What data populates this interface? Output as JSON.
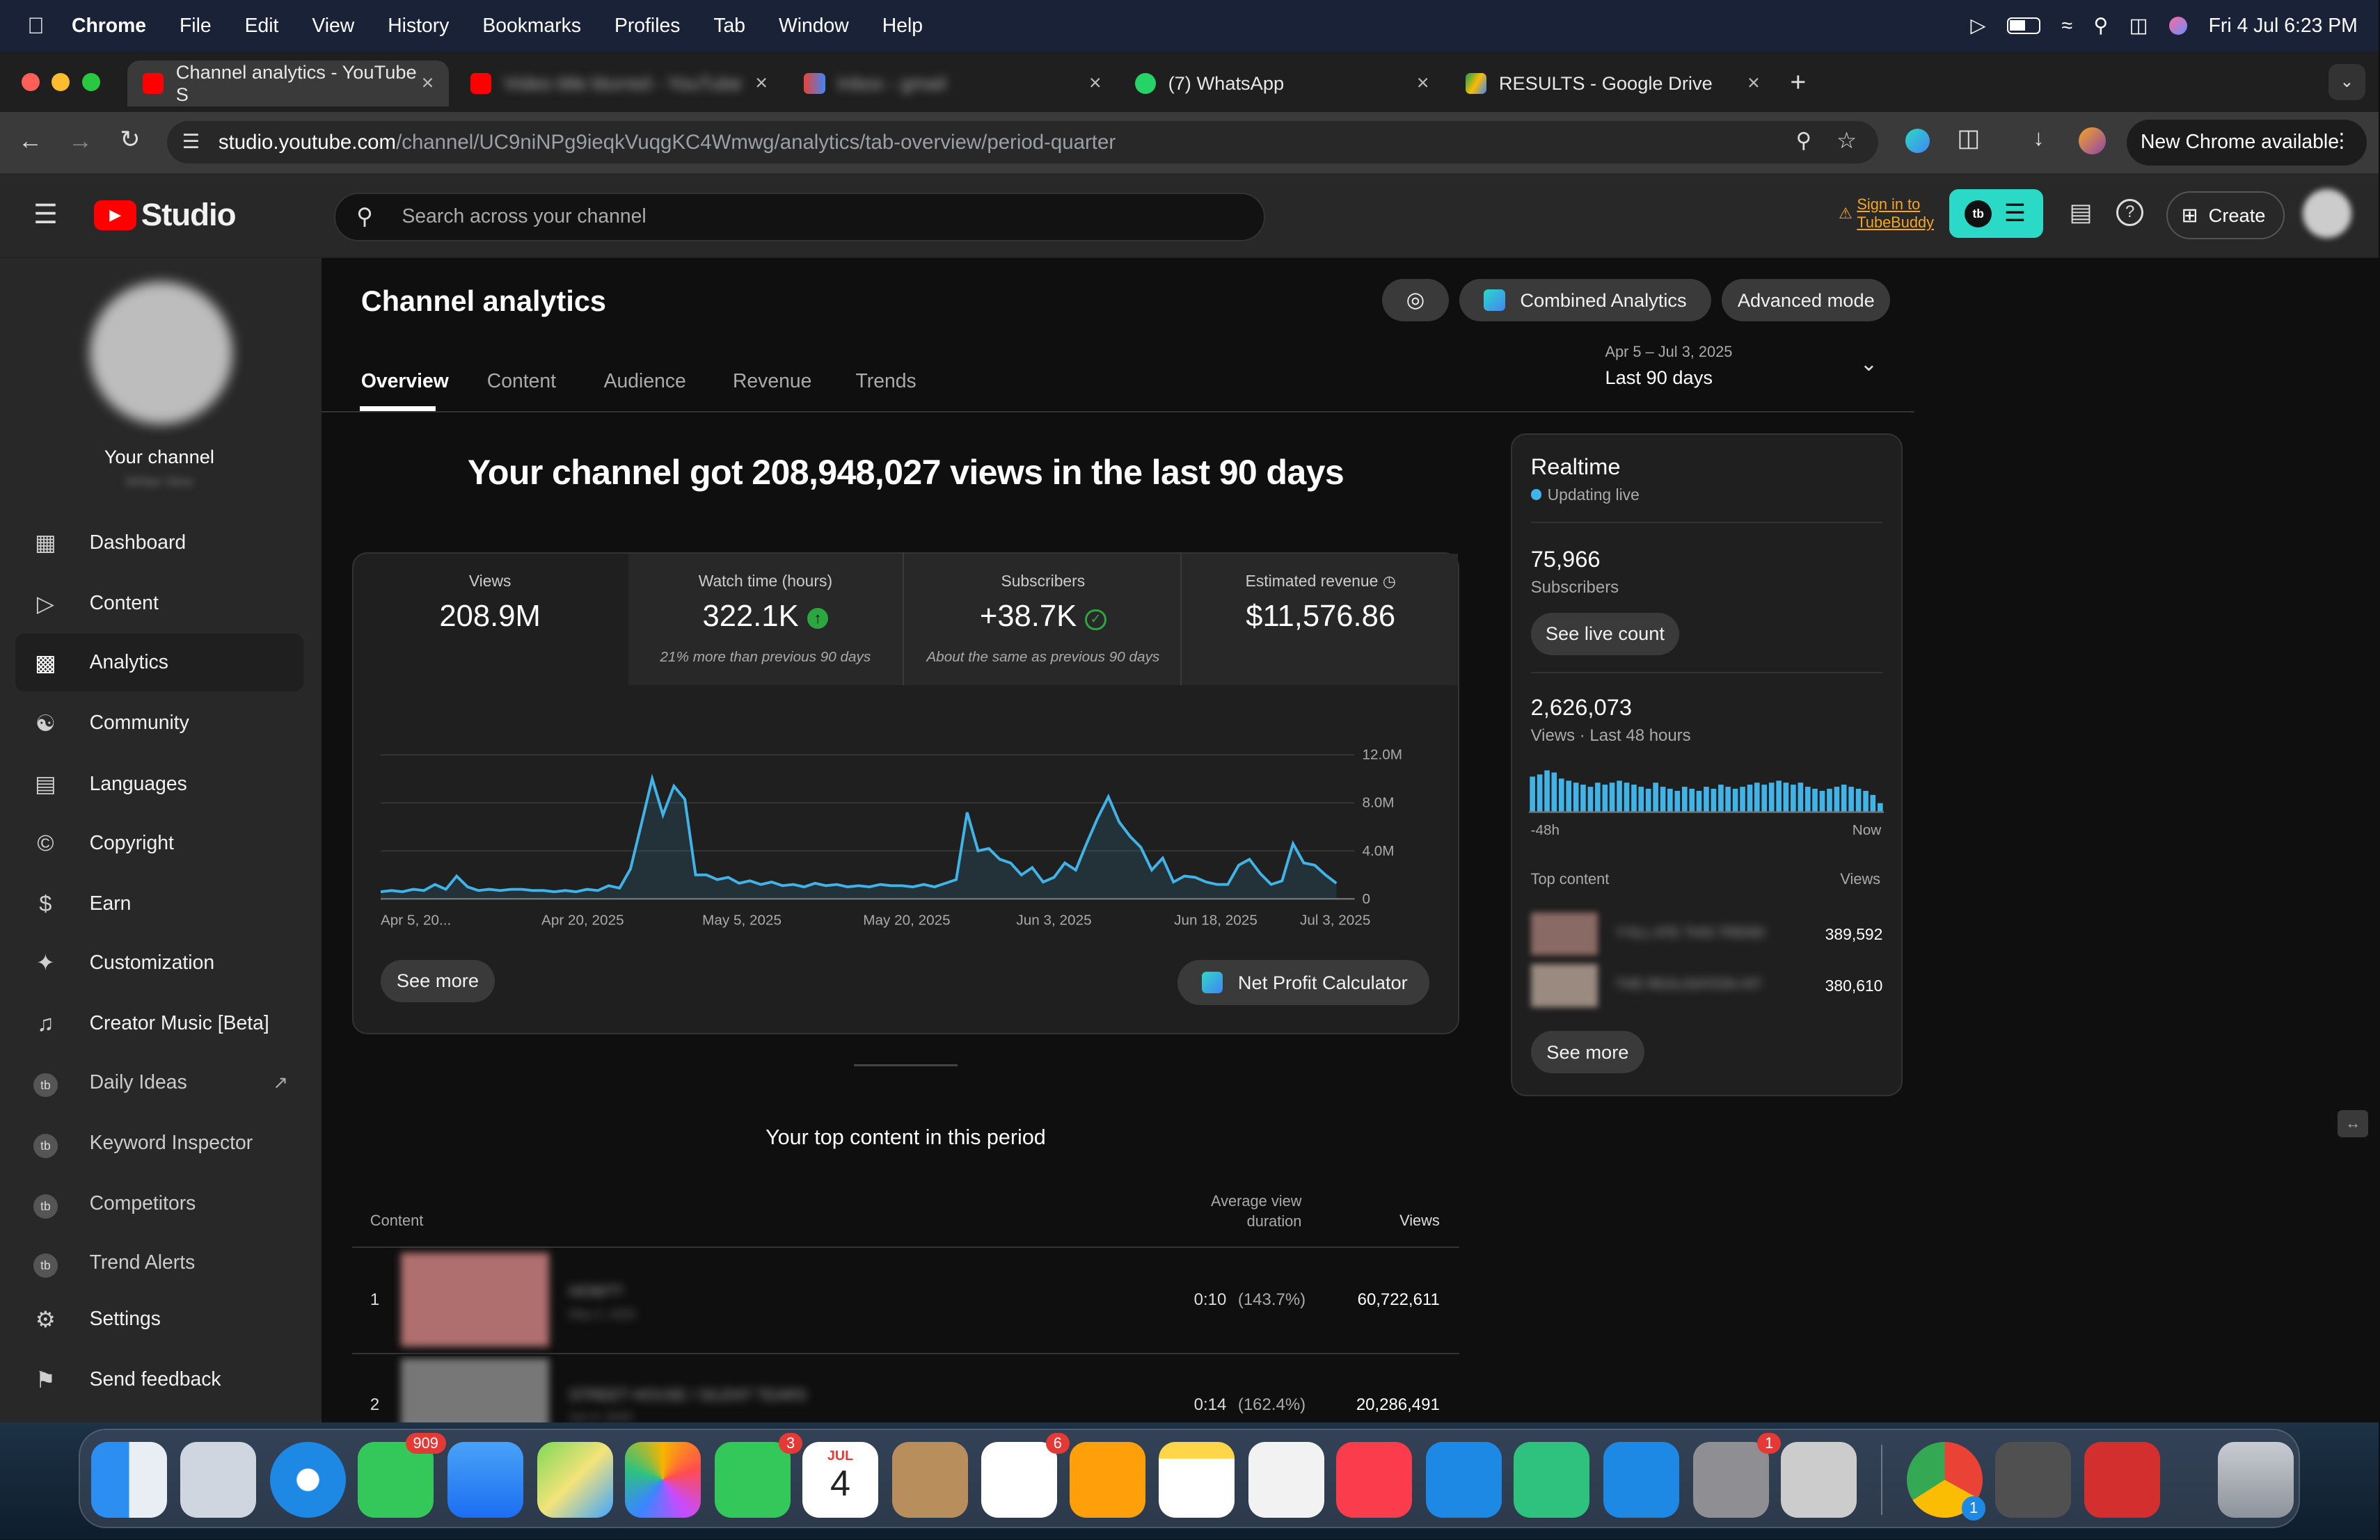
{
  "menubar": {
    "app": "Chrome",
    "items": [
      "File",
      "Edit",
      "View",
      "History",
      "Bookmarks",
      "Profiles",
      "Tab",
      "Window",
      "Help"
    ],
    "datetime": "Fri 4 Jul  6:23 PM"
  },
  "tabs": [
    {
      "title": "Channel analytics - YouTube S"
    },
    {
      "title": "Video title blurred - YouTube"
    },
    {
      "title": "Inbox - gmail"
    },
    {
      "title": "(7) WhatsApp"
    },
    {
      "title": "RESULTS - Google Drive"
    }
  ],
  "address": {
    "domain": "studio.youtube.com",
    "path": "/channel/UC9niNPg9ieqkVuqgKC4Wmwg/analytics/tab-overview/period-quarter",
    "new_chrome": "New Chrome available"
  },
  "header": {
    "logo": "Studio",
    "search_placeholder": "Search across your channel",
    "signin_1": "Sign in to",
    "signin_2": "TubeBuddy",
    "create": "Create"
  },
  "sidebar": {
    "channel_label": "Your channel",
    "channel_name": "Writer Hive",
    "items": [
      {
        "label": "Dashboard",
        "icon": "dashboard-icon"
      },
      {
        "label": "Content",
        "icon": "content-icon"
      },
      {
        "label": "Analytics",
        "icon": "analytics-icon"
      },
      {
        "label": "Community",
        "icon": "community-icon"
      },
      {
        "label": "Languages",
        "icon": "languages-icon"
      },
      {
        "label": "Copyright",
        "icon": "copyright-icon"
      },
      {
        "label": "Earn",
        "icon": "earn-icon"
      },
      {
        "label": "Customization",
        "icon": "customization-icon"
      },
      {
        "label": "Creator Music [Beta]",
        "icon": "music-icon"
      },
      {
        "label": "Daily Ideas",
        "icon": "tubebuddy-icon"
      },
      {
        "label": "Keyword Inspector",
        "icon": "tubebuddy-icon"
      },
      {
        "label": "Competitors",
        "icon": "tubebuddy-icon"
      },
      {
        "label": "Trend Alerts",
        "icon": "tubebuddy-icon"
      },
      {
        "label": "Settings",
        "icon": "gear-icon"
      },
      {
        "label": "Send feedback",
        "icon": "feedback-icon"
      }
    ]
  },
  "page": {
    "title": "Channel analytics",
    "combined": "Combined Analytics",
    "advanced": "Advanced mode",
    "date_range": "Apr 5 – Jul 3, 2025",
    "period": "Last 90 days",
    "tabs": [
      "Overview",
      "Content",
      "Audience",
      "Revenue",
      "Trends"
    ],
    "headline": "Your channel got 208,948,027 views in the last 90 days"
  },
  "metrics": [
    {
      "label": "Views",
      "value": "208.9M",
      "sub": ""
    },
    {
      "label": "Watch time (hours)",
      "value": "322.1K",
      "sub": "21% more than previous 90 days"
    },
    {
      "label": "Subscribers",
      "value": "+38.7K",
      "sub": "About the same as previous 90 days"
    },
    {
      "label": "Estimated revenue",
      "value": "$11,576.86",
      "sub": ""
    }
  ],
  "chart_data": {
    "type": "area",
    "x_ticks": [
      "Apr 5, 20...",
      "Apr 20, 2025",
      "May 5, 2025",
      "May 20, 2025",
      "Jun 3, 2025",
      "Jun 18, 2025",
      "Jul 3, 2025"
    ],
    "y_ticks": [
      "12.0M",
      "8.0M",
      "4.0M",
      "0"
    ],
    "ylim": [
      0,
      12000000
    ],
    "values": [
      0.6,
      0.7,
      0.6,
      0.8,
      0.7,
      1.2,
      0.8,
      1.9,
      1.0,
      0.7,
      0.8,
      0.7,
      0.8,
      0.8,
      0.7,
      0.7,
      0.6,
      0.7,
      0.6,
      0.8,
      0.7,
      1.1,
      0.9,
      2.5,
      6.2,
      10.0,
      7.0,
      9.4,
      8.3,
      2.0,
      2.0,
      1.6,
      1.8,
      1.3,
      1.5,
      1.2,
      1.4,
      1.1,
      1.2,
      1.0,
      1.3,
      1.1,
      1.2,
      1.0,
      1.1,
      1.0,
      1.2,
      1.1,
      1.1,
      1.0,
      1.2,
      1.0,
      1.3,
      1.6,
      7.2,
      4.0,
      4.2,
      3.3,
      3.0,
      2.0,
      2.6,
      1.4,
      1.8,
      3.0,
      2.4,
      4.6,
      6.7,
      8.5,
      6.4,
      5.2,
      4.3,
      2.4,
      3.4,
      1.4,
      1.9,
      1.8,
      1.4,
      1.2,
      1.2,
      2.8,
      3.3,
      2.1,
      1.2,
      1.5,
      4.6,
      3.0,
      2.8,
      2.0,
      1.3
    ]
  },
  "buttons": {
    "see_more": "See more",
    "net_profit": "Net Profit Calculator",
    "see_live": "See live count",
    "see_more_rt": "See more"
  },
  "realtime": {
    "title": "Realtime",
    "status": "Updating live",
    "subs_value": "75,966",
    "subs_label": "Subscribers",
    "views_value": "2,626,073",
    "views_label": "Views · Last 48 hours",
    "bar_start": "-48h",
    "bar_end": "Now",
    "bars": [
      0.85,
      0.9,
      1.0,
      0.95,
      0.8,
      0.75,
      0.7,
      0.65,
      0.6,
      0.7,
      0.65,
      0.7,
      0.75,
      0.7,
      0.65,
      0.6,
      0.55,
      0.7,
      0.6,
      0.55,
      0.5,
      0.6,
      0.55,
      0.5,
      0.6,
      0.55,
      0.65,
      0.6,
      0.55,
      0.6,
      0.65,
      0.7,
      0.65,
      0.7,
      0.75,
      0.7,
      0.65,
      0.7,
      0.6,
      0.55,
      0.5,
      0.55,
      0.6,
      0.65,
      0.6,
      0.55,
      0.5,
      0.4,
      0.2
    ],
    "top_label": "Top content",
    "views_col": "Views",
    "top_items": [
      {
        "title": "Y'ALL ATE THIS TREND",
        "views": "389,592"
      },
      {
        "title": "THE REALISATION HIT",
        "views": "380,610"
      }
    ]
  },
  "top_content": {
    "title": "Your top content in this period",
    "col_content": "Content",
    "col_avd": "Average view duration",
    "col_views": "Views",
    "rows": [
      {
        "rank": "1",
        "title": "HOW??",
        "date": "May 2, 2025",
        "avd": "0:10",
        "avd_pct": "(143.7%)",
        "views": "60,722,611"
      },
      {
        "rank": "2",
        "title": "STREET HOUSE / SILENT TEARS",
        "date": "Jun 4, 2025",
        "avd": "0:14",
        "avd_pct": "(162.4%)",
        "views": "20,286,491"
      }
    ]
  },
  "dock": {
    "apps": [
      "finder-icon",
      "launchpad-icon",
      "safari-icon",
      "messages-icon",
      "mail-icon",
      "maps-icon",
      "photos-icon",
      "facetime-icon",
      "calendar-icon",
      "contacts-icon",
      "reminders-icon",
      "pages-icon",
      "notes-icon",
      "freeform-icon",
      "music-icon",
      "keynote-icon",
      "numbers-icon",
      "appstore-icon",
      "settings-icon",
      "iphone-mirror-icon",
      "chrome-icon",
      "calculator-icon",
      "photobooth-icon",
      "trash-icon"
    ],
    "messages_badge": "909",
    "facetime_badge": "3",
    "reminders_badge": "6",
    "settings_badge": "1",
    "chrome_badge": "1",
    "calendar_month": "JUL",
    "calendar_day": "4"
  },
  "colors": {
    "accent": "#3ea6ff",
    "youtube_red": "#ff0000",
    "tubebuddy": "#2bd9c7",
    "chart_line": "#41b3e6"
  }
}
